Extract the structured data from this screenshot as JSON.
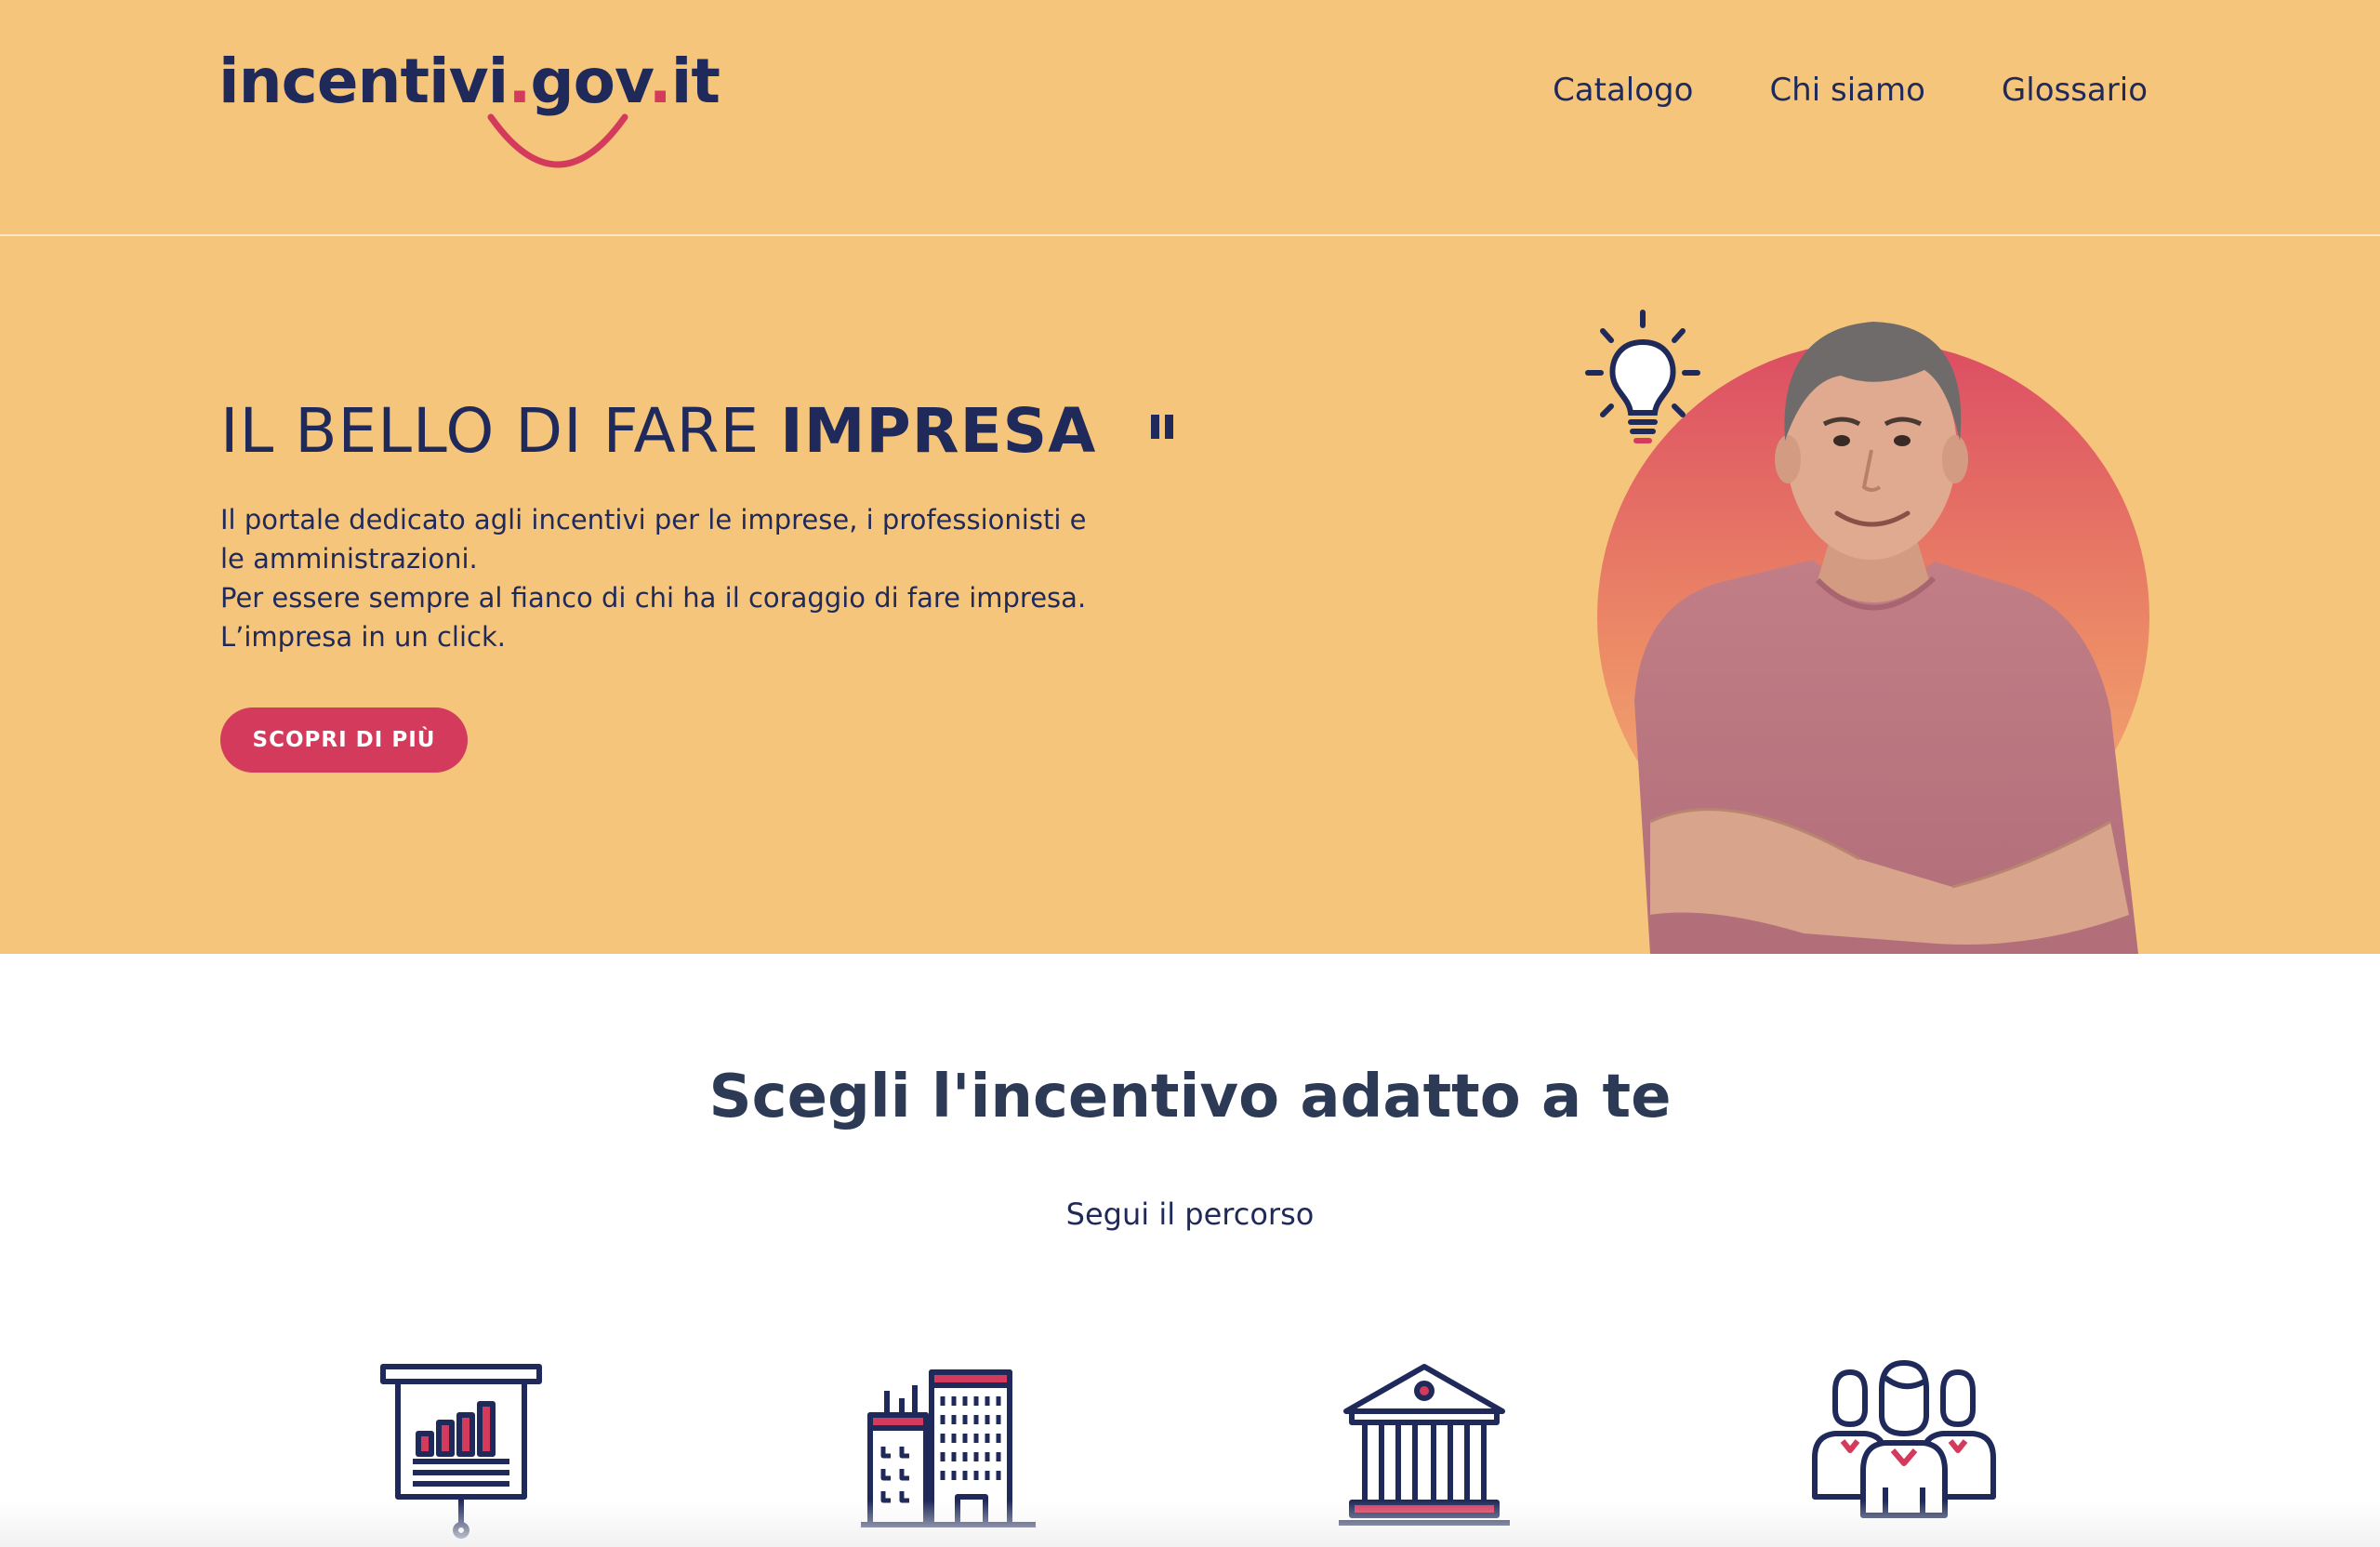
{
  "header": {
    "logo": {
      "part1": "incentivi",
      "dot1": ".",
      "part2": "gov",
      "dot2": ".",
      "part3": "it"
    },
    "nav": [
      {
        "label": "Catalogo"
      },
      {
        "label": "Chi siamo"
      },
      {
        "label": "Glossario"
      }
    ]
  },
  "hero": {
    "title_light": "IL BELLO DI FARE ",
    "title_strong": "IMPRESA",
    "paragraphs": [
      "Il portale dedicato agli incentivi per le imprese, i professionisti e le amministrazioni.",
      "Per essere sempre al fianco di chi ha il coraggio di fare impresa.",
      "L’impresa in un click."
    ],
    "button_label": "SCOPRI DI PIÙ"
  },
  "section": {
    "title": "Scegli l'incentivo adatto a te",
    "subtitle": "Segui il percorso"
  },
  "categories": [
    {
      "icon": "presentation-chart-icon"
    },
    {
      "icon": "office-buildings-icon"
    },
    {
      "icon": "public-institution-icon"
    },
    {
      "icon": "group-people-icon"
    }
  ],
  "colors": {
    "background": "#f5c57b",
    "navy": "#1f2a5a",
    "accent": "#d43a5c",
    "heading": "#2d3a55"
  }
}
